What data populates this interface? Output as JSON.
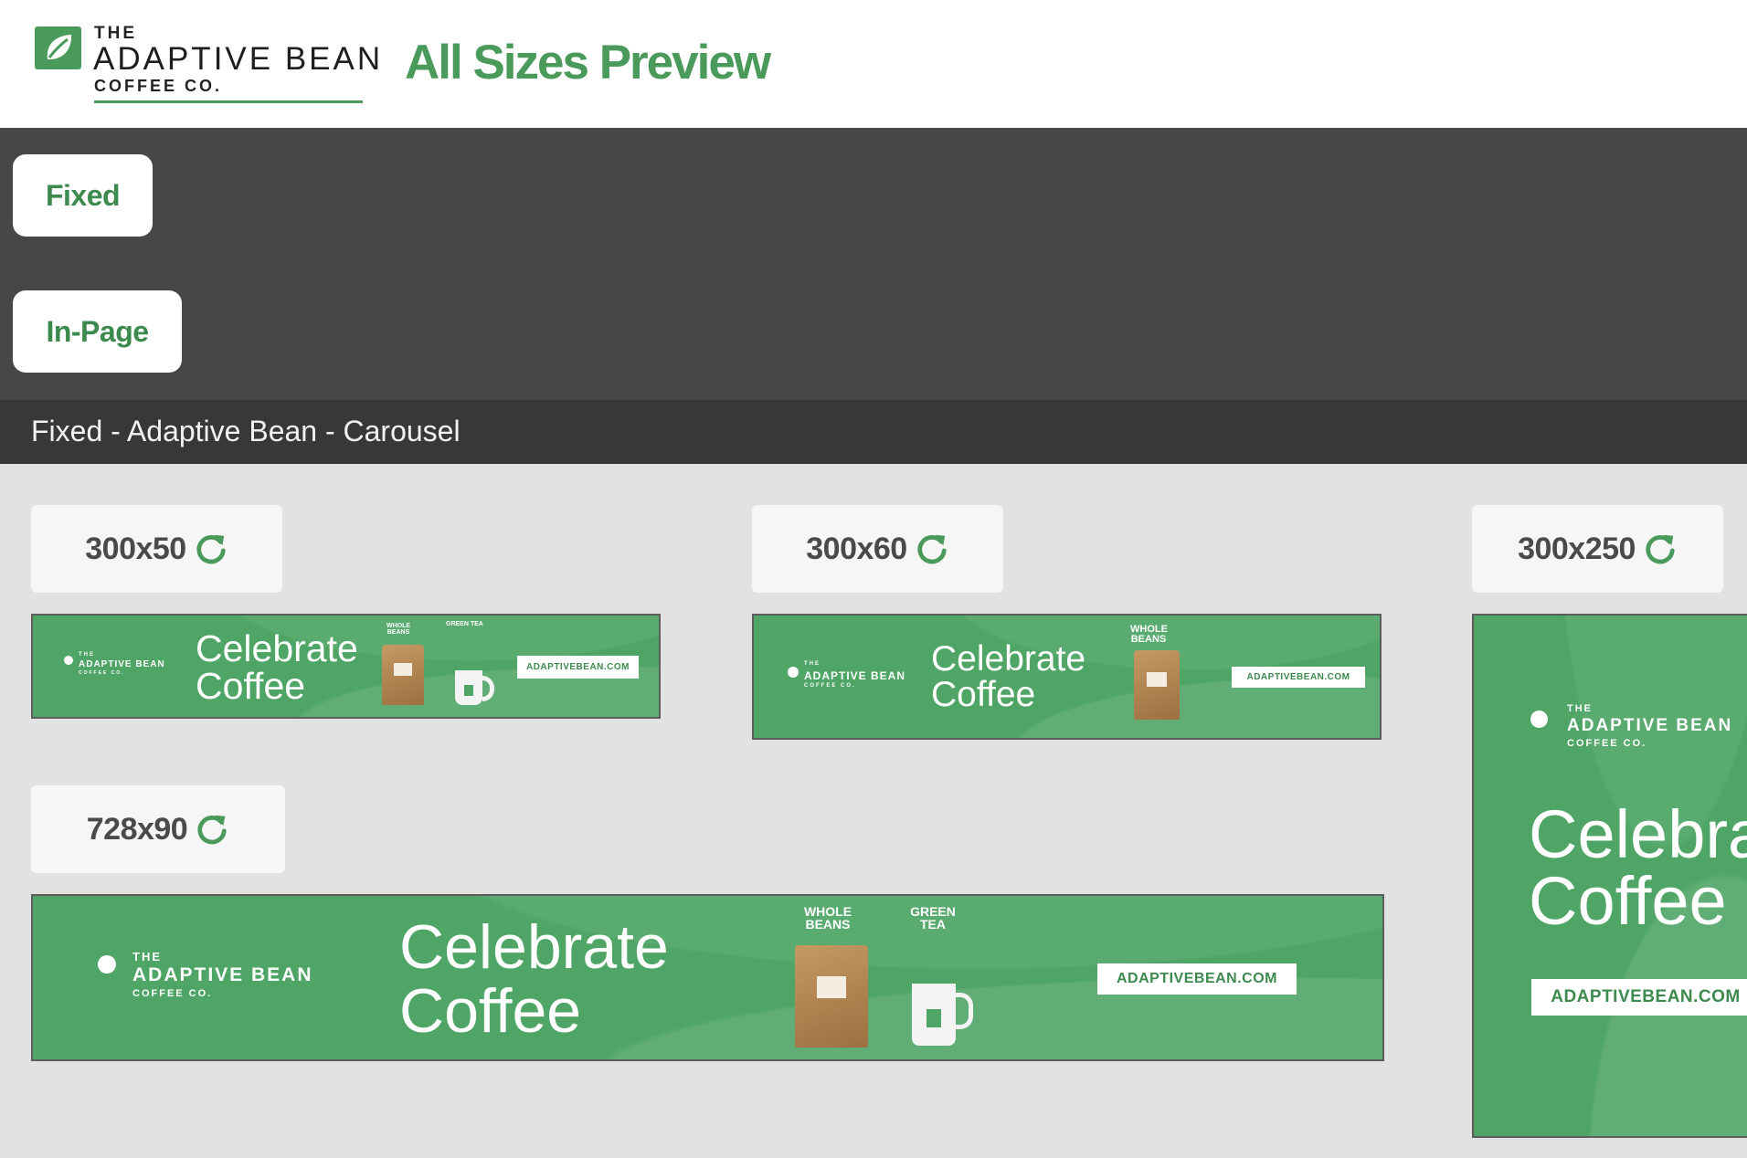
{
  "header": {
    "logo": {
      "line1": "THE",
      "line2": "ADAPTIVE BEAN",
      "line3": "COFFEE CO."
    },
    "title": "All Sizes Preview"
  },
  "nav": {
    "buttons": [
      {
        "label": "Fixed"
      },
      {
        "label": "In-Page"
      }
    ]
  },
  "section": {
    "title": "Fixed - Adaptive Bean - Carousel"
  },
  "colors": {
    "brand_green": "#4a9a5b",
    "ad_green": "#4ea565",
    "nav_dark": "#474747",
    "section_dark": "#383838"
  },
  "icons": {
    "reload": "reload-icon",
    "leaf": "leaf-icon"
  },
  "ads": [
    {
      "size_label": "300x50",
      "brand": {
        "line1": "THE",
        "line2": "ADAPTIVE BEAN",
        "line3": "COFFEE CO."
      },
      "headline": [
        "Celebrate",
        "Coffee"
      ],
      "products": [
        "WHOLE BEANS",
        "GREEN TEA"
      ],
      "cta": "ADAPTIVEBEAN.COM"
    },
    {
      "size_label": "300x60",
      "brand": {
        "line1": "THE",
        "line2": "ADAPTIVE BEAN",
        "line3": "COFFEE CO."
      },
      "headline": [
        "Celebrate",
        "Coffee"
      ],
      "products": [
        "WHOLE BEANS"
      ],
      "cta": "ADAPTIVEBEAN.COM"
    },
    {
      "size_label": "300x250",
      "brand": {
        "line1": "THE",
        "line2": "ADAPTIVE BEAN",
        "line3": "COFFEE CO."
      },
      "headline": [
        "Celebra",
        "Coffee"
      ],
      "cta": "ADAPTIVEBEAN.COM"
    },
    {
      "size_label": "728x90",
      "brand": {
        "line1": "THE",
        "line2": "ADAPTIVE BEAN",
        "line3": "COFFEE CO."
      },
      "headline": [
        "Celebrate",
        "Coffee"
      ],
      "products": [
        "WHOLE BEANS",
        "GREEN TEA"
      ],
      "cta": "ADAPTIVEBEAN.COM"
    }
  ]
}
